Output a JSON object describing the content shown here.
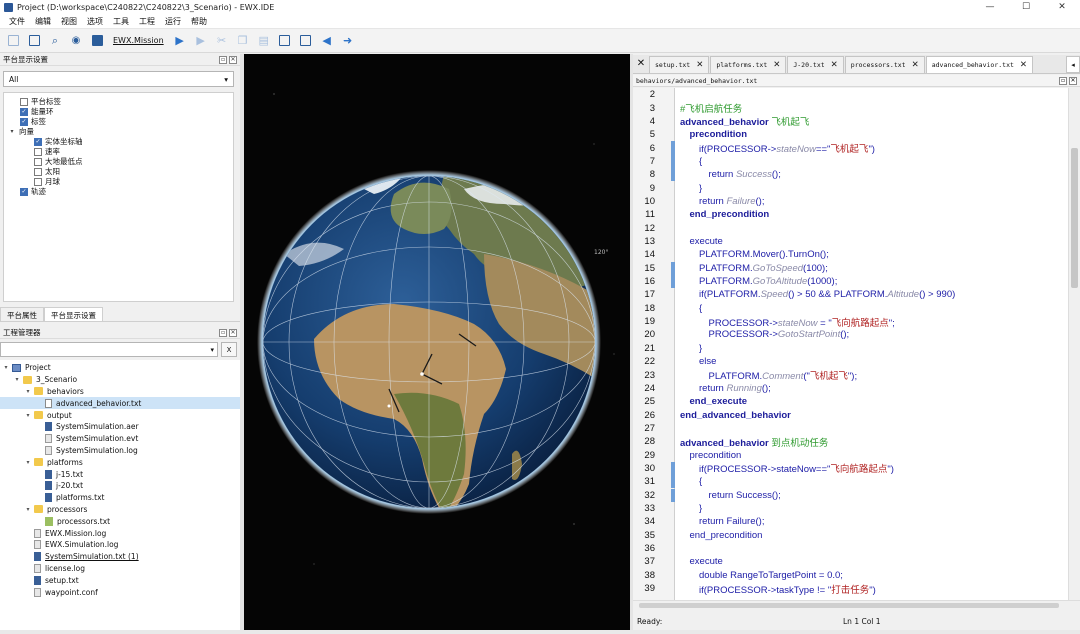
{
  "window": {
    "title": "Project (D:\\workspace\\C240822\\C240822\\3_Scenario) - EWX.IDE",
    "controls": [
      "—",
      "☐",
      "✕"
    ]
  },
  "menu": [
    "文件",
    "编辑",
    "视图",
    "选项",
    "工具",
    "工程",
    "运行",
    "帮助"
  ],
  "toolbar": {
    "mission_label": "EWX.Mission"
  },
  "platform_display": {
    "header": "平台显示设置",
    "select_value": "All",
    "layers": [
      {
        "label": "平台标签",
        "checked": false
      },
      {
        "label": "能量环",
        "checked": true
      },
      {
        "label": "标签",
        "checked": true
      },
      {
        "label": "向量",
        "group": true
      },
      {
        "label": "实体坐标轴",
        "checked": true
      },
      {
        "label": "速率",
        "checked": false
      },
      {
        "label": "大地最低点",
        "checked": false
      },
      {
        "label": "太阳",
        "checked": false
      },
      {
        "label": "月球",
        "checked": false
      },
      {
        "label": "轨迹",
        "checked": true
      }
    ],
    "tabs": [
      "平台属性",
      "平台显示设置"
    ]
  },
  "project_manager": {
    "header": "工程管理器",
    "button_label": "X",
    "tree": [
      {
        "label": "Project",
        "depth": 0,
        "icon": "proj",
        "expanded": true
      },
      {
        "label": "3_Scenario",
        "depth": 1,
        "icon": "folder",
        "expanded": true
      },
      {
        "label": "behaviors",
        "depth": 2,
        "icon": "folder",
        "expanded": true
      },
      {
        "label": "advanced_behavior.txt",
        "depth": 3,
        "icon": "file",
        "selected": true
      },
      {
        "label": "output",
        "depth": 2,
        "icon": "folder",
        "expanded": true
      },
      {
        "label": "SystemSimulation.aer",
        "depth": 3,
        "icon": "bin"
      },
      {
        "label": "SystemSimulation.evt",
        "depth": 3,
        "icon": "text"
      },
      {
        "label": "SystemSimulation.log",
        "depth": 3,
        "icon": "text"
      },
      {
        "label": "platforms",
        "depth": 2,
        "icon": "folder",
        "expanded": true
      },
      {
        "label": "j-15.txt",
        "depth": 3,
        "icon": "bin"
      },
      {
        "label": "j-20.txt",
        "depth": 3,
        "icon": "bin"
      },
      {
        "label": "platforms.txt",
        "depth": 3,
        "icon": "bin"
      },
      {
        "label": "processors",
        "depth": 2,
        "icon": "folder",
        "expanded": true
      },
      {
        "label": "processors.txt",
        "depth": 3,
        "icon": "proc"
      },
      {
        "label": "EWX.Mission.log",
        "depth": 2,
        "icon": "text"
      },
      {
        "label": "EWX.Simulation.log",
        "depth": 2,
        "icon": "text"
      },
      {
        "label": "SystemSimulation.txt (1)",
        "depth": 2,
        "icon": "bin",
        "underline": true
      },
      {
        "label": "license.log",
        "depth": 2,
        "icon": "text"
      },
      {
        "label": "setup.txt",
        "depth": 2,
        "icon": "bin"
      },
      {
        "label": "waypoint.conf",
        "depth": 2,
        "icon": "text"
      }
    ]
  },
  "globe": {
    "range_label": "120°"
  },
  "editor": {
    "tabs": [
      {
        "label": "setup.txt",
        "active": false
      },
      {
        "label": "platforms.txt",
        "active": false
      },
      {
        "label": "J-20.txt",
        "active": false
      },
      {
        "label": "processors.txt",
        "active": false
      },
      {
        "label": "advanced_behavior.txt",
        "active": true
      }
    ],
    "path": "behaviors/advanced_behavior.txt",
    "lines": [
      {
        "n": "2",
        "indent": 0,
        "parts": []
      },
      {
        "n": "3",
        "indent": 0,
        "parts": [
          {
            "t": "#飞机启航任务",
            "c": "comment"
          }
        ]
      },
      {
        "n": "4",
        "indent": 0,
        "parts": [
          {
            "t": "advanced_behavior ",
            "c": "kw"
          },
          {
            "t": "飞机起飞",
            "c": "comment"
          }
        ]
      },
      {
        "n": "5",
        "indent": 1,
        "parts": [
          {
            "t": "precondition",
            "c": "kw"
          }
        ]
      },
      {
        "n": "6",
        "indent": 2,
        "parts": [
          {
            "t": "if(PROCESSOR->",
            "c": "plain"
          },
          {
            "t": "stateNow",
            "c": "italic"
          },
          {
            "t": "==\"",
            "c": "plain"
          },
          {
            "t": "飞机起飞",
            "c": "str"
          },
          {
            "t": "\")",
            "c": "plain"
          }
        ]
      },
      {
        "n": "7",
        "indent": 2,
        "parts": [
          {
            "t": "{",
            "c": "plain"
          }
        ]
      },
      {
        "n": "8",
        "indent": 3,
        "parts": [
          {
            "t": "return ",
            "c": "plain"
          },
          {
            "t": "Success",
            "c": "italic"
          },
          {
            "t": "();",
            "c": "plain"
          }
        ]
      },
      {
        "n": "9",
        "indent": 2,
        "parts": [
          {
            "t": "}",
            "c": "plain"
          }
        ]
      },
      {
        "n": "10",
        "indent": 2,
        "parts": [
          {
            "t": "return ",
            "c": "plain"
          },
          {
            "t": "Failure",
            "c": "italic"
          },
          {
            "t": "();",
            "c": "plain"
          }
        ]
      },
      {
        "n": "11",
        "indent": 1,
        "parts": [
          {
            "t": "end_precondition",
            "c": "kw"
          }
        ]
      },
      {
        "n": "12",
        "indent": 0,
        "parts": []
      },
      {
        "n": "13",
        "indent": 1,
        "parts": [
          {
            "t": "execute",
            "c": "plain"
          }
        ]
      },
      {
        "n": "14",
        "indent": 2,
        "parts": [
          {
            "t": "PLATFORM.Mover().TurnOn();",
            "c": "plain"
          }
        ]
      },
      {
        "n": "15",
        "indent": 2,
        "parts": [
          {
            "t": "PLATFORM.",
            "c": "plain"
          },
          {
            "t": "GoToSpeed",
            "c": "italic"
          },
          {
            "t": "(100);",
            "c": "plain"
          }
        ]
      },
      {
        "n": "16",
        "indent": 2,
        "parts": [
          {
            "t": "PLATFORM.",
            "c": "plain"
          },
          {
            "t": "GoToAltitude",
            "c": "italic"
          },
          {
            "t": "(1000);",
            "c": "plain"
          }
        ]
      },
      {
        "n": "17",
        "indent": 2,
        "parts": [
          {
            "t": "if(PLATFORM.",
            "c": "plain"
          },
          {
            "t": "Speed",
            "c": "italic"
          },
          {
            "t": "() > 50 && PLATFORM.",
            "c": "plain"
          },
          {
            "t": "Altitude",
            "c": "italic"
          },
          {
            "t": "() > 990)",
            "c": "plain"
          }
        ]
      },
      {
        "n": "18",
        "indent": 2,
        "parts": [
          {
            "t": "{",
            "c": "plain"
          }
        ]
      },
      {
        "n": "19",
        "indent": 3,
        "parts": [
          {
            "t": "PROCESSOR->",
            "c": "plain"
          },
          {
            "t": "stateNow",
            "c": "italic"
          },
          {
            "t": " = \"",
            "c": "plain"
          },
          {
            "t": "飞向航路起点",
            "c": "str"
          },
          {
            "t": "\";",
            "c": "plain"
          }
        ]
      },
      {
        "n": "20",
        "indent": 3,
        "parts": [
          {
            "t": "PROCESSOR->",
            "c": "plain"
          },
          {
            "t": "GotoStartPoint",
            "c": "italic"
          },
          {
            "t": "();",
            "c": "plain"
          }
        ]
      },
      {
        "n": "21",
        "indent": 2,
        "parts": [
          {
            "t": "}",
            "c": "plain"
          }
        ]
      },
      {
        "n": "22",
        "indent": 2,
        "parts": [
          {
            "t": "else",
            "c": "plain"
          }
        ]
      },
      {
        "n": "23",
        "indent": 3,
        "parts": [
          {
            "t": "PLATFORM.",
            "c": "plain"
          },
          {
            "t": "Comment",
            "c": "italic"
          },
          {
            "t": "(\"",
            "c": "plain"
          },
          {
            "t": "飞机起飞",
            "c": "str"
          },
          {
            "t": "\");",
            "c": "plain"
          }
        ]
      },
      {
        "n": "24",
        "indent": 2,
        "parts": [
          {
            "t": "return ",
            "c": "plain"
          },
          {
            "t": "Running",
            "c": "italic"
          },
          {
            "t": "();",
            "c": "plain"
          }
        ]
      },
      {
        "n": "25",
        "indent": 1,
        "parts": [
          {
            "t": "end_execute",
            "c": "kw"
          }
        ]
      },
      {
        "n": "26",
        "indent": 0,
        "parts": [
          {
            "t": "end_advanced_behavior",
            "c": "kw"
          }
        ]
      },
      {
        "n": "27",
        "indent": 0,
        "parts": []
      },
      {
        "n": "28",
        "indent": 0,
        "parts": [
          {
            "t": "advanced_behavior ",
            "c": "kw"
          },
          {
            "t": "到点机动任务",
            "c": "comment"
          }
        ]
      },
      {
        "n": "29",
        "indent": 1,
        "parts": [
          {
            "t": "precondition",
            "c": "plain"
          }
        ]
      },
      {
        "n": "30",
        "indent": 2,
        "parts": [
          {
            "t": "if(PROCESSOR->stateNow==\"",
            "c": "plain"
          },
          {
            "t": "飞向航路起点",
            "c": "str"
          },
          {
            "t": "\")",
            "c": "plain"
          }
        ]
      },
      {
        "n": "31",
        "indent": 2,
        "parts": [
          {
            "t": "{",
            "c": "plain"
          }
        ]
      },
      {
        "n": "32",
        "indent": 3,
        "parts": [
          {
            "t": "return Success();",
            "c": "plain"
          }
        ]
      },
      {
        "n": "33",
        "indent": 2,
        "parts": [
          {
            "t": "}",
            "c": "plain"
          }
        ]
      },
      {
        "n": "34",
        "indent": 2,
        "parts": [
          {
            "t": "return Failure();",
            "c": "plain"
          }
        ]
      },
      {
        "n": "35",
        "indent": 1,
        "parts": [
          {
            "t": "end_precondition",
            "c": "plain"
          }
        ]
      },
      {
        "n": "36",
        "indent": 0,
        "parts": []
      },
      {
        "n": "37",
        "indent": 1,
        "parts": [
          {
            "t": "execute",
            "c": "plain"
          }
        ]
      },
      {
        "n": "38",
        "indent": 2,
        "parts": [
          {
            "t": "double RangeToTargetPoint = 0.0;",
            "c": "plain"
          }
        ]
      },
      {
        "n": "39",
        "indent": 2,
        "parts": [
          {
            "t": "if(PROCESSOR->taskType != \"",
            "c": "plain"
          },
          {
            "t": "打击任务",
            "c": "str"
          },
          {
            "t": "\")",
            "c": "plain"
          }
        ]
      }
    ],
    "changed_lines": [
      "6",
      "7",
      "8",
      "15",
      "16",
      "30",
      "31",
      "32"
    ]
  },
  "status": {
    "text": "Ready:",
    "position": "Ln 1   Col 1"
  },
  "colors": {
    "accent": "#2d73c9",
    "keyword": "#1c1c9a",
    "comment": "#2e9a2e",
    "string": "#b02222",
    "change_marker": "#6f9fd8"
  }
}
